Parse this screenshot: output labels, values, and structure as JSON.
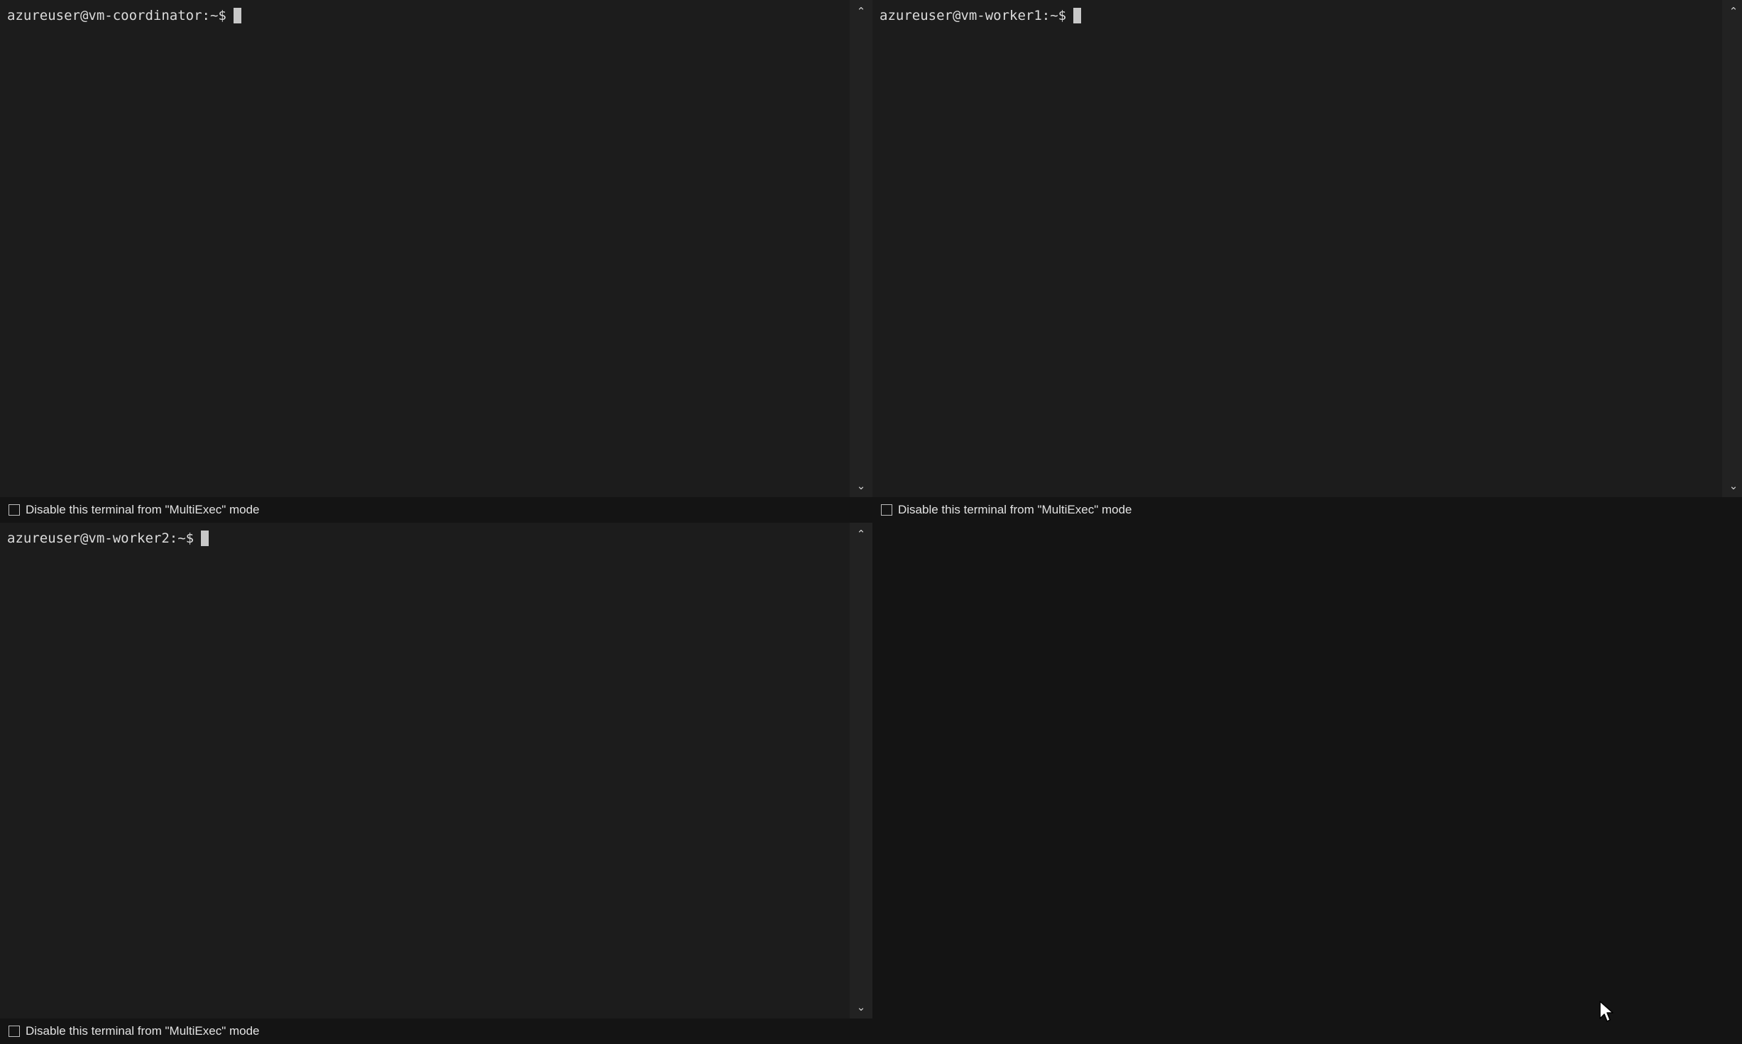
{
  "terminals": [
    {
      "id": "coordinator",
      "prompt": "azureuser@vm-coordinator:~$",
      "multiexec_label": "Disable this terminal from \"MultiExec\" mode",
      "multiexec_disabled": false
    },
    {
      "id": "worker1",
      "prompt": "azureuser@vm-worker1:~$",
      "multiexec_label": "Disable this terminal from \"MultiExec\" mode",
      "multiexec_disabled": false
    },
    {
      "id": "worker2",
      "prompt": "azureuser@vm-worker2:~$",
      "multiexec_label": "Disable this terminal from \"MultiExec\" mode",
      "multiexec_disabled": false
    }
  ],
  "icons": {
    "scroll_up": "chevron-up-icon",
    "scroll_down": "chevron-down-icon",
    "pointer": "mouse-pointer-icon"
  },
  "colors": {
    "terminal_bg": "#1c1c1c",
    "app_bg": "#141414",
    "text": "#dcdcdc",
    "cursor": "#c8c8c8"
  }
}
